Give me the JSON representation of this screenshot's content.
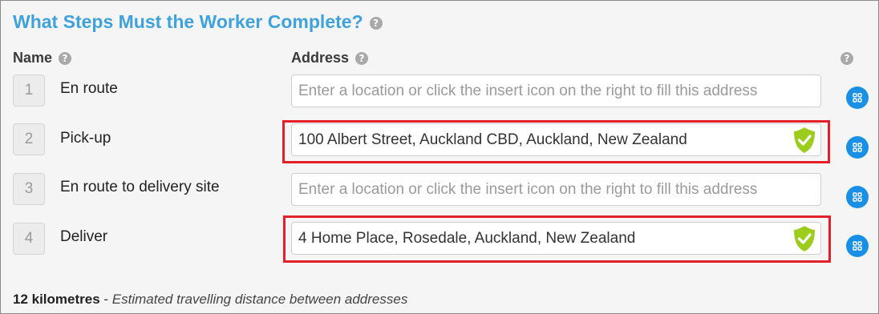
{
  "title": "What Steps Must the Worker Complete?",
  "headers": {
    "name": "Name",
    "address": "Address"
  },
  "steps": [
    {
      "num": "1",
      "name": "En route",
      "address": "",
      "placeholder": "Enter a location or click the insert icon on the right to fill this address"
    },
    {
      "num": "2",
      "name": "Pick-up",
      "address": "100 Albert Street, Auckland CBD, Auckland, New Zealand",
      "placeholder": ""
    },
    {
      "num": "3",
      "name": "En route to delivery site",
      "address": "",
      "placeholder": "Enter a location or click the insert icon on the right to fill this address"
    },
    {
      "num": "4",
      "name": "Deliver",
      "address": "4 Home Place, Rosedale, Auckland, New Zealand",
      "placeholder": ""
    }
  ],
  "footer": {
    "distance": "12 kilometres",
    "separator": " - ",
    "description": "Estimated travelling distance between addresses"
  },
  "icons": {
    "help": "help-icon",
    "check": "check-shield-icon",
    "insert": "insert-grid-icon"
  },
  "colors": {
    "title": "#3fa2dc",
    "highlight": "#e3202a",
    "check": "#9ccc1c",
    "insert": "#1a8fe6"
  }
}
